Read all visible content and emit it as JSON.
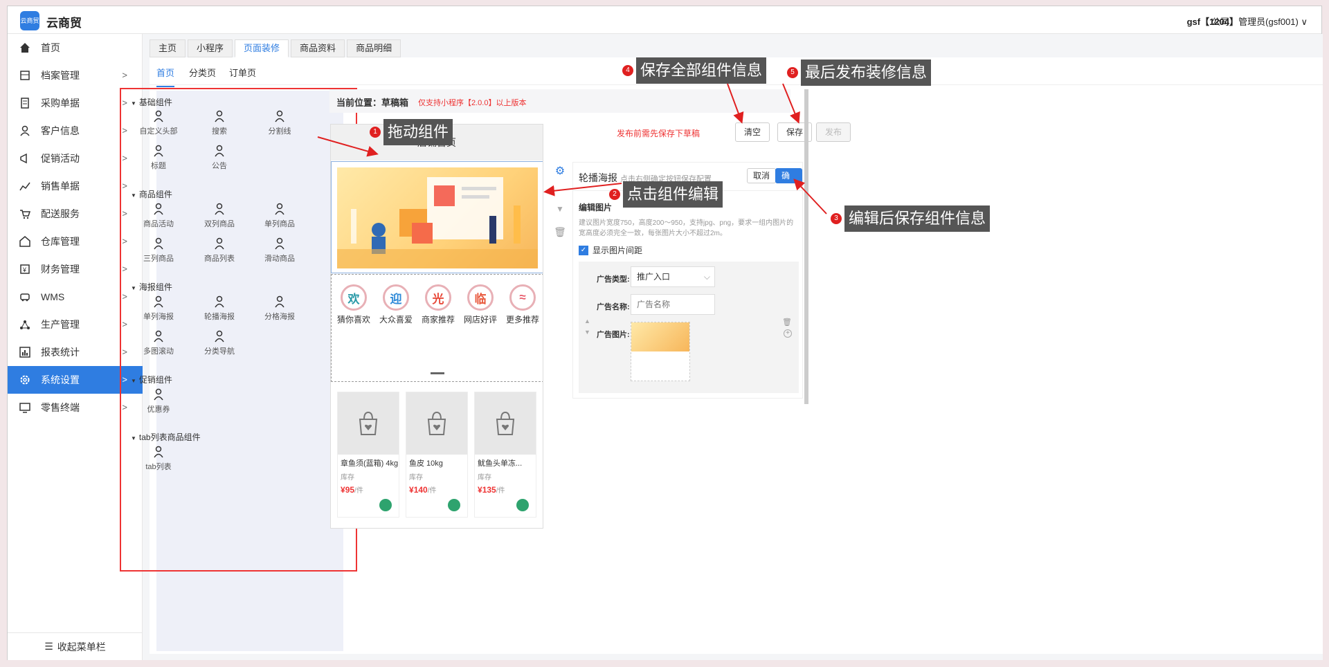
{
  "app": {
    "name": "云商贸",
    "logo_text": "云商贸",
    "user": "gsf【1204】",
    "company": "公司：管理员(gsf001) ∨"
  },
  "sidebar": {
    "items": [
      {
        "label": "首页",
        "icon": "home-icon"
      },
      {
        "label": "档案管理",
        "icon": "archive-icon"
      },
      {
        "label": "采购单据",
        "icon": "purchase-icon"
      },
      {
        "label": "客户信息",
        "icon": "customer-icon"
      },
      {
        "label": "促销活动",
        "icon": "promotion-icon"
      },
      {
        "label": "销售单据",
        "icon": "sales-icon"
      },
      {
        "label": "配送服务",
        "icon": "delivery-icon"
      },
      {
        "label": "仓库管理",
        "icon": "warehouse-icon"
      },
      {
        "label": "财务管理",
        "icon": "finance-icon"
      },
      {
        "label": "WMS",
        "icon": "wms-icon"
      },
      {
        "label": "生产管理",
        "icon": "production-icon"
      },
      {
        "label": "报表统计",
        "icon": "report-icon"
      },
      {
        "label": "系统设置",
        "icon": "settings-icon"
      },
      {
        "label": "零售终端",
        "icon": "retail-icon"
      }
    ],
    "collapse_label": "收起菜单栏"
  },
  "tabs": [
    "主页",
    "小程序",
    "页面装修",
    "商品资料",
    "商品明细"
  ],
  "subtabs": [
    "首页",
    "分类页",
    "订单页"
  ],
  "components": {
    "groups": [
      {
        "title": "基础组件",
        "items": [
          "自定义头部",
          "搜索",
          "分割线",
          "标题",
          "公告"
        ]
      },
      {
        "title": "商品组件",
        "items": [
          "商品活动",
          "双列商品",
          "单列商品",
          "三列商品",
          "商品列表",
          "滑动商品"
        ]
      },
      {
        "title": "海报组件",
        "items": [
          "单列海报",
          "轮播海报",
          "分格海报",
          "多图滚动",
          "分类导航"
        ]
      },
      {
        "title": "促销组件",
        "items": [
          "优惠券"
        ]
      },
      {
        "title": "tab列表商品组件",
        "items": [
          "tab列表"
        ]
      }
    ]
  },
  "location": {
    "label": "当前位置：草稿箱",
    "note": "仅支持小程序【2.0.0】以上版本"
  },
  "toolbar": {
    "warn": "发布前需先保存下草稿",
    "clear": "清空",
    "save": "保存",
    "publish": "发布"
  },
  "phone": {
    "title": "店铺首页",
    "nav": [
      {
        "label": "猜你喜欢",
        "char": "欢",
        "color": "#2a9aa8"
      },
      {
        "label": "大众喜爱",
        "char": "迎",
        "color": "#2f8ad8"
      },
      {
        "label": "商家推荐",
        "char": "光",
        "color": "#e84a3a"
      },
      {
        "label": "网店好评",
        "char": "临",
        "color": "#e8563a"
      },
      {
        "label": "更多推荐",
        "char": "≈",
        "color": "#e85a6a"
      }
    ],
    "products": [
      {
        "name": "章鱼须(蓝箱) 4kg",
        "stock": "库存",
        "price": "95",
        "unit": "/件"
      },
      {
        "name": "鱼皮 10kg",
        "stock": "库存",
        "price": "140",
        "unit": "/件"
      },
      {
        "name": "鱿鱼头单冻...",
        "stock": "库存",
        "price": "135",
        "unit": "/件"
      }
    ],
    "currency": "¥"
  },
  "editor": {
    "title": "轮播海报",
    "hint": "点击右侧确定按钮保存配置",
    "cancel": "取消",
    "confirm": "确定",
    "section": "编辑图片",
    "desc": "建议图片宽度750，高度200～950，支持jpg、png，要求一组内图片的宽高度必须完全一致，每张图片大小不超过2m。",
    "spacing_label": "显示图片间距",
    "spacing_checked": true,
    "ad_type_label": "广告类型:",
    "ad_type_value": "推广入口",
    "ad_name_label": "广告名称:",
    "ad_name_placeholder": "广告名称",
    "ad_image_label": "广告图片:"
  },
  "annotations": [
    {
      "num": "1",
      "text": "拖动组件"
    },
    {
      "num": "2",
      "text": "点击组件编辑"
    },
    {
      "num": "3",
      "text": "编辑后保存组件信息"
    },
    {
      "num": "4",
      "text": "保存全部组件信息"
    },
    {
      "num": "5",
      "text": "最后发布装修信息"
    }
  ],
  "colors": {
    "accent": "#2f7de1",
    "annotation_red": "#e02020",
    "highlight_box": "#ee3333"
  }
}
